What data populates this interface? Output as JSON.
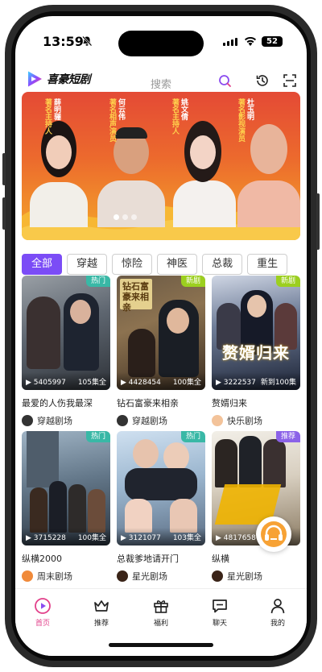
{
  "status_bar": {
    "time": "13:59",
    "battery": "52"
  },
  "header": {
    "logo_text": "喜豪短剧",
    "search_label": "搜索"
  },
  "banner": {
    "hosts": [
      {
        "name": "薛明骊",
        "title": "著名主持人"
      },
      {
        "name": "何云伟",
        "title": "著名相声演员"
      },
      {
        "name": "姚文倩",
        "title": "著名主持人"
      },
      {
        "name": "杜玉明",
        "title": "著名影视演员"
      }
    ],
    "page_count": 3,
    "current_page": 1
  },
  "category_tabs": [
    "全部",
    "穿越",
    "惊险",
    "神医",
    "总裁",
    "重生"
  ],
  "active_tab": "全部",
  "dramas": [
    {
      "badge": "热门",
      "badge_type": "hot",
      "views": "5405997",
      "episodes": "105集全",
      "title": "最爱的人伤我最深",
      "studio": "穿越剧场"
    },
    {
      "badge": "新剧",
      "badge_type": "new",
      "views": "4428454",
      "episodes": "100集全",
      "title": "钻石富豪来相亲",
      "studio": "穿越剧场"
    },
    {
      "badge": "新剧",
      "badge_type": "new",
      "views": "3222537",
      "episodes": "新到100集",
      "title": "赘婿归来",
      "studio": "快乐剧场"
    },
    {
      "badge": "热门",
      "badge_type": "hot",
      "views": "3715228",
      "episodes": "100集全",
      "title": "纵横2000",
      "studio": "周末剧场"
    },
    {
      "badge": "热门",
      "badge_type": "hot",
      "views": "3121077",
      "episodes": "103集全",
      "title": "总裁爹地请开门",
      "studio": "星光剧场"
    },
    {
      "badge": "推荐",
      "badge_type": "rec",
      "views": "4817658",
      "episodes": "",
      "title": "纵横",
      "studio": "星光剧场"
    }
  ],
  "poster_text": {
    "p2": "钻石富豪来相亲",
    "p3": "赘婿归来"
  },
  "tab_bar": [
    {
      "label": "首页",
      "icon": "home-play-icon",
      "active": true
    },
    {
      "label": "推荐",
      "icon": "crown-icon",
      "active": false
    },
    {
      "label": "福利",
      "icon": "gift-icon",
      "active": false
    },
    {
      "label": "聊天",
      "icon": "chat-icon",
      "active": false
    },
    {
      "label": "我的",
      "icon": "user-icon",
      "active": false
    }
  ],
  "colors": {
    "accent": "#7b4cf6",
    "tab_active": "#e2408a",
    "hot_badge": "#39b8a6",
    "new_badge": "#9ccf1f",
    "rec_badge": "#8b62e8"
  }
}
